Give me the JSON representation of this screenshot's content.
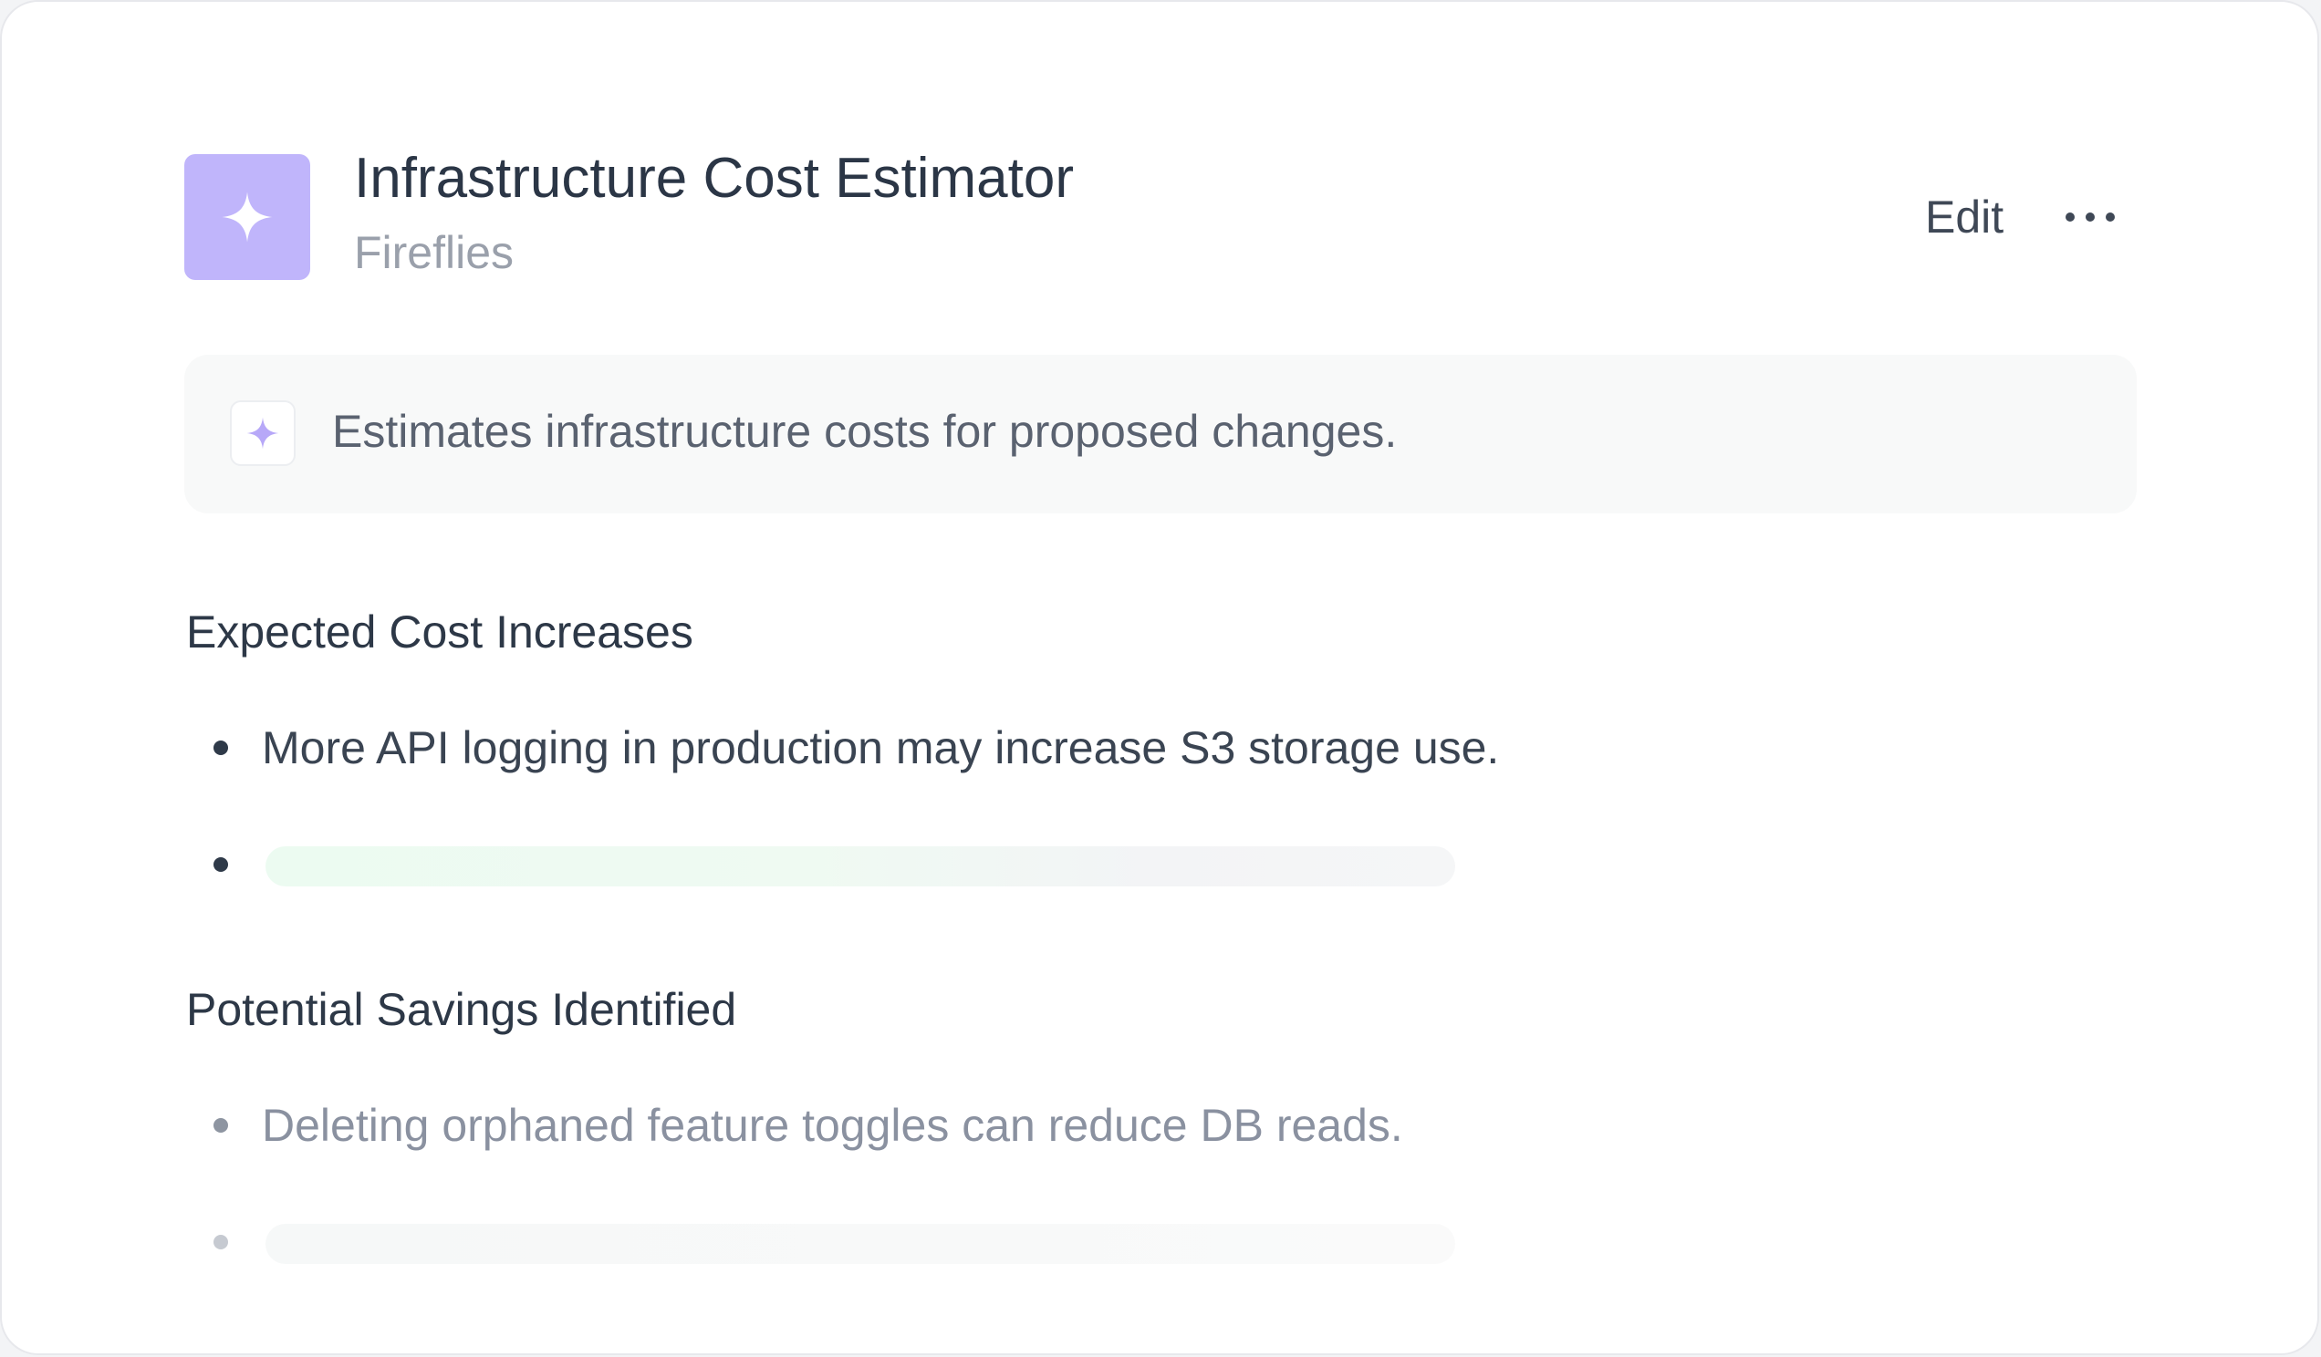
{
  "header": {
    "title": "Infrastructure Cost Estimator",
    "subtitle": "Fireflies",
    "icon": "sparkle-icon",
    "edit_label": "Edit",
    "more_icon": "more-horizontal-icon"
  },
  "description": {
    "icon": "sparkle-icon",
    "text": "Estimates infrastructure costs for proposed changes."
  },
  "sections": [
    {
      "heading": "Expected Cost Increases",
      "items": [
        "More API logging in production may increase S3 storage use."
      ],
      "loading_placeholder": true
    },
    {
      "heading": "Potential Savings Identified",
      "items": [
        "Deleting orphaned feature toggles can reduce DB reads."
      ],
      "loading_placeholder": true
    }
  ],
  "colors": {
    "accent": "#c0b5fb",
    "accent_icon": "#b7a8f8",
    "heading_text": "#2b3646",
    "muted_text": "#9aa0ab",
    "description_background": "#f8f9f9"
  }
}
